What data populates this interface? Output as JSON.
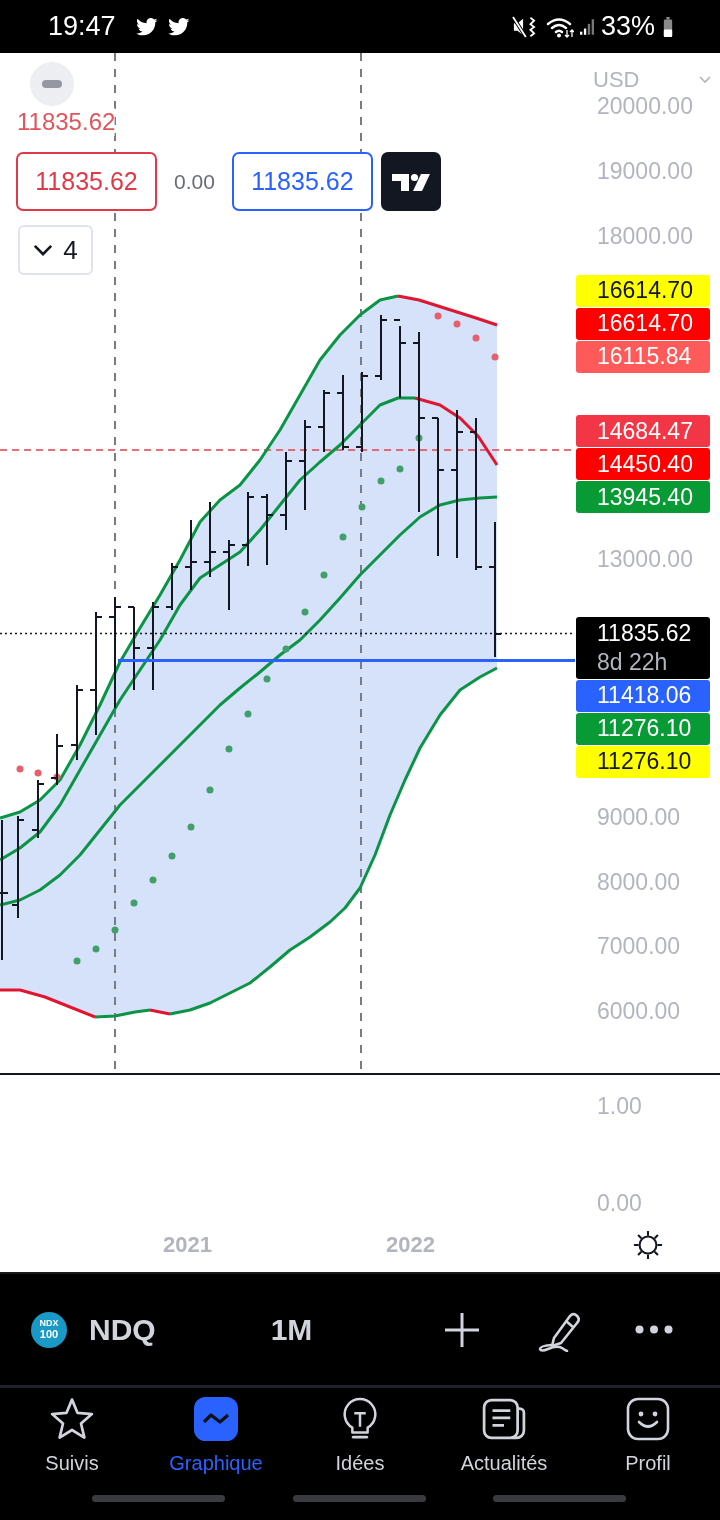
{
  "status_bar": {
    "time": "19:47",
    "battery": "33%"
  },
  "legend": {
    "price": "11835.62",
    "bid": "11835.62",
    "spread": "0.00",
    "ask": "11835.62",
    "indicator_count": "4",
    "expanded": false
  },
  "price_axis": {
    "currency": "USD",
    "ticks": [
      "20000.00",
      "19000.00",
      "18000.00",
      "13000.00",
      "9000.00",
      "8000.00",
      "7000.00",
      "6000.00"
    ]
  },
  "price_tags": [
    {
      "kind": "level",
      "value": "16614.70",
      "color": "#ffff00"
    },
    {
      "kind": "level",
      "value": "16614.70",
      "color": "#ff0000"
    },
    {
      "kind": "level",
      "value": "16115.84",
      "color": "#ff5a5a"
    },
    {
      "kind": "level",
      "value": "14684.47",
      "color": "#f23645"
    },
    {
      "kind": "level",
      "value": "14450.40",
      "color": "#ff0000"
    },
    {
      "kind": "level",
      "value": "13945.40",
      "color": "#089b35"
    },
    {
      "kind": "last",
      "value": "11835.62",
      "countdown": "8d 22h",
      "color": "#000000"
    },
    {
      "kind": "level",
      "value": "11418.06",
      "color": "#2962ff"
    },
    {
      "kind": "level",
      "value": "11276.10",
      "color": "#089b35"
    },
    {
      "kind": "level",
      "value": "11276.10",
      "color": "#ffff00"
    }
  ],
  "lower_pane": {
    "ticks": [
      "1.00",
      "0.00"
    ]
  },
  "time_axis": {
    "labels": [
      "2021",
      "2022"
    ]
  },
  "toolbar": {
    "logo_lines": [
      "NDX",
      "100"
    ],
    "symbol": "NDQ",
    "interval": "1M"
  },
  "tab_bar": [
    {
      "label": "Suivis",
      "selected": false
    },
    {
      "label": "Graphique",
      "selected": true
    },
    {
      "label": "Idées",
      "selected": false
    },
    {
      "label": "Actualités",
      "selected": false
    },
    {
      "label": "Profil",
      "selected": false
    }
  ]
}
